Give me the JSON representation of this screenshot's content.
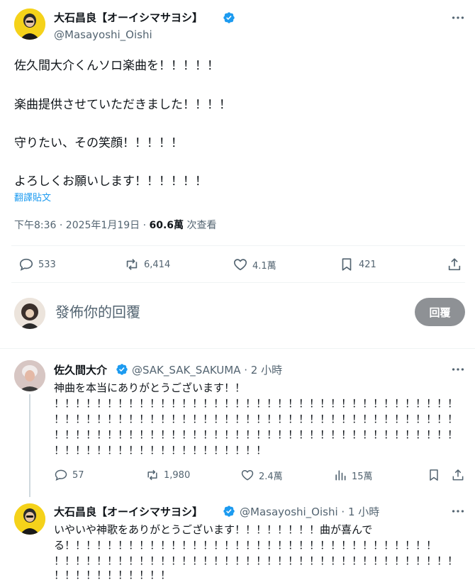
{
  "post": {
    "author_name": "大石昌良【オーイシマサヨシ】",
    "author_handle": "@Masayoshi_Oishi",
    "lines": [
      "佐久間大介くんソロ楽曲を！！！！！",
      "楽曲提供させていただきました！！！！",
      "守りたい、その笑顔！！！！！",
      "よろしくお願いします！！！！！！"
    ],
    "translate_label": "翻譯貼文",
    "timestamp": "下午8:36 · 2025年1月19日 · ",
    "views_count": "60.6萬",
    "views_label": " 次查看",
    "stats": {
      "replies": "533",
      "reposts": "6,414",
      "likes": "4.1萬",
      "bookmarks": "421"
    }
  },
  "composer": {
    "placeholder": "發佈你的回覆",
    "reply_button": "回覆"
  },
  "replies": [
    {
      "author_name": "佐久間大介",
      "author_meta": "@SAK_SAK_SAKUMA · 2 小時",
      "lines": [
        "神曲を本当にありがとうございます！！",
        "！！！！！！！！！！！！！！！！！！！！！！！！！！！！！！！！！！！！！！",
        "！！！！！！！！！！！！！！！！！！！！！！！！！！！！！！！！！！！！！！",
        "！！！！！！！！！！！！！！！！！！！！！！！！！！！！！！！！！！！！！！",
        "！！！！！！！！！！！！！！！！！！！！"
      ],
      "stats": {
        "replies": "57",
        "reposts": "1,980",
        "likes": "2.4萬",
        "views": "15萬"
      }
    },
    {
      "author_name": "大石昌良【オーイシマサヨシ】",
      "author_meta": "@Masayoshi_Oishi · 1 小時",
      "lines": [
        "いやいや神歌をありがとうございます！！！！！！！！曲が喜んで",
        "る！！！！！！！！！！！！！！！！！！！！！！！！！！！！！！！！！！！",
        "！！！！！！！！！！！！！！！！！！！！！！！！！！！！！！！！！！！！！！",
        "！！！！！！！！！！！"
      ]
    }
  ],
  "colors": {
    "verified": "#1d9bf0",
    "accent": "#1d9bf0"
  }
}
